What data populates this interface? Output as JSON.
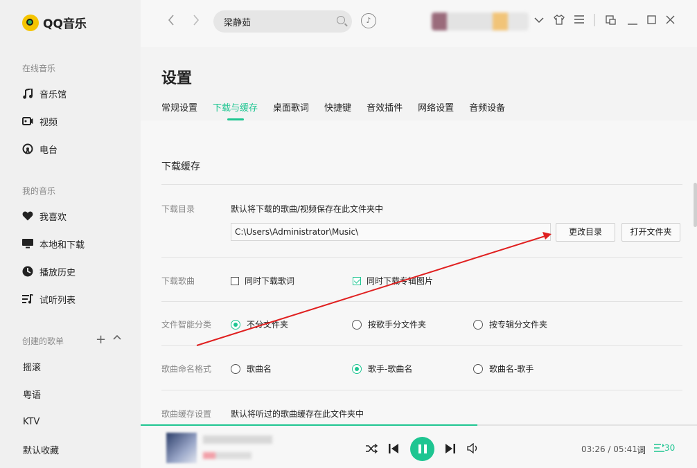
{
  "app": {
    "name": "QQ音乐"
  },
  "sidebar": {
    "online_section": "在线音乐",
    "online_items": [
      {
        "label": "音乐馆",
        "icon": "music-note-icon"
      },
      {
        "label": "视频",
        "icon": "video-icon"
      },
      {
        "label": "电台",
        "icon": "radio-icon"
      }
    ],
    "my_section": "我的音乐",
    "my_items": [
      {
        "label": "我喜欢",
        "icon": "heart-icon"
      },
      {
        "label": "本地和下载",
        "icon": "monitor-icon"
      },
      {
        "label": "播放历史",
        "icon": "clock-icon"
      },
      {
        "label": "试听列表",
        "icon": "playlist-icon"
      }
    ],
    "created_section": "创建的歌单",
    "playlists": [
      "摇滚",
      "粤语",
      "KTV",
      "默认收藏"
    ]
  },
  "topbar": {
    "search_value": "梁静茹"
  },
  "settings": {
    "title": "设置",
    "tabs": [
      "常规设置",
      "下载与缓存",
      "桌面歌词",
      "快捷键",
      "音效插件",
      "网络设置",
      "音频设备"
    ],
    "active_tab": "下载与缓存",
    "section_title": "下载缓存",
    "download_dir": {
      "label": "下载目录",
      "desc": "默认将下载的歌曲/视频保存在此文件夹中",
      "path": "C:\\Users\\Administrator\\Music\\",
      "change_button": "更改目录",
      "open_button": "打开文件夹"
    },
    "download_songs": {
      "label": "下载歌曲",
      "opt1": "同时下载歌词",
      "opt1_checked": false,
      "opt2": "同时下载专辑图片",
      "opt2_checked": true
    },
    "smart_classify": {
      "label": "文件智能分类",
      "options": [
        "不分文件夹",
        "按歌手分文件夹",
        "按专辑分文件夹"
      ],
      "selected": "不分文件夹"
    },
    "naming": {
      "label": "歌曲命名格式",
      "options": [
        "歌曲名",
        "歌手-歌曲名",
        "歌曲名-歌手"
      ],
      "selected": "歌手-歌曲名"
    },
    "cache": {
      "label": "歌曲缓存设置",
      "desc": "默认将听过的歌曲缓存在此文件夹中"
    }
  },
  "player": {
    "progress": 0.605,
    "time": "03:26 / 05:41",
    "lyric_label": "词",
    "queue_count": "30"
  },
  "colors": {
    "accent": "#1ec591",
    "annotation": "#e02020"
  }
}
